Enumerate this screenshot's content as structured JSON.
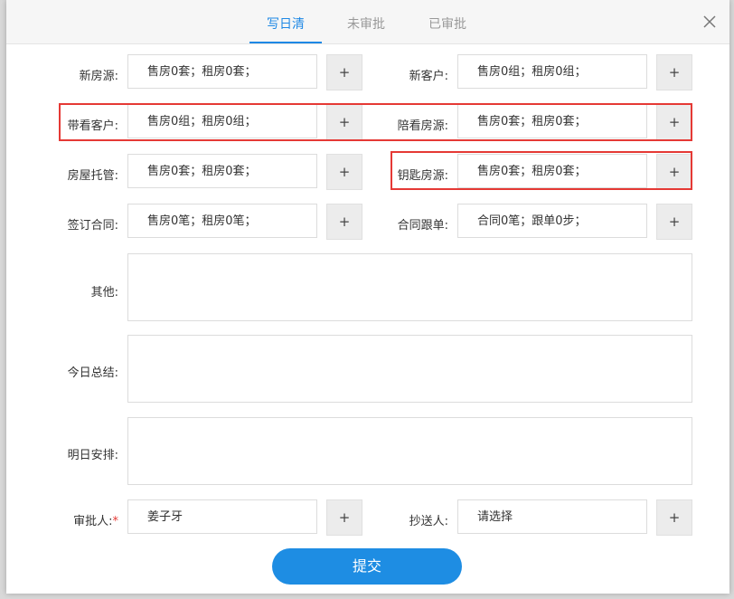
{
  "tabs": [
    {
      "label": "写日清",
      "active": true
    },
    {
      "label": "未审批",
      "active": false
    },
    {
      "label": "已审批",
      "active": false
    }
  ],
  "rows": {
    "new_listings": {
      "label": "新房源:",
      "value": "售房0套；租房0套；"
    },
    "new_customers": {
      "label": "新客户:",
      "value": "售房0组；租房0组；"
    },
    "showing_customers": {
      "label": "带看客户:",
      "value": "售房0组；租房0组；"
    },
    "showing_listings": {
      "label": "陪看房源:",
      "value": "售房0套；租房0套；"
    },
    "property_custody": {
      "label": "房屋托管:",
      "value": "售房0套；租房0套；"
    },
    "key_listings": {
      "label": "钥匙房源:",
      "value": "售房0套；租房0套；"
    },
    "contracts": {
      "label": "签订合同:",
      "value": "售房0笔；租房0笔；"
    },
    "contract_followup": {
      "label": "合同跟单:",
      "value": "合同0笔；跟单0步；"
    }
  },
  "plus_label": "+",
  "other": {
    "label": "其他:"
  },
  "summary": {
    "label": "今日总结:"
  },
  "plan": {
    "label": "明日安排:"
  },
  "approver": {
    "label": "审批人:",
    "required_mark": "*",
    "value": "姜子牙"
  },
  "cc": {
    "label": "抄送人:",
    "value": "请选择"
  },
  "submit_label": "提交",
  "colors": {
    "accent": "#1e88e5",
    "highlight": "#e53935"
  },
  "icons": {
    "close": "close-icon"
  }
}
